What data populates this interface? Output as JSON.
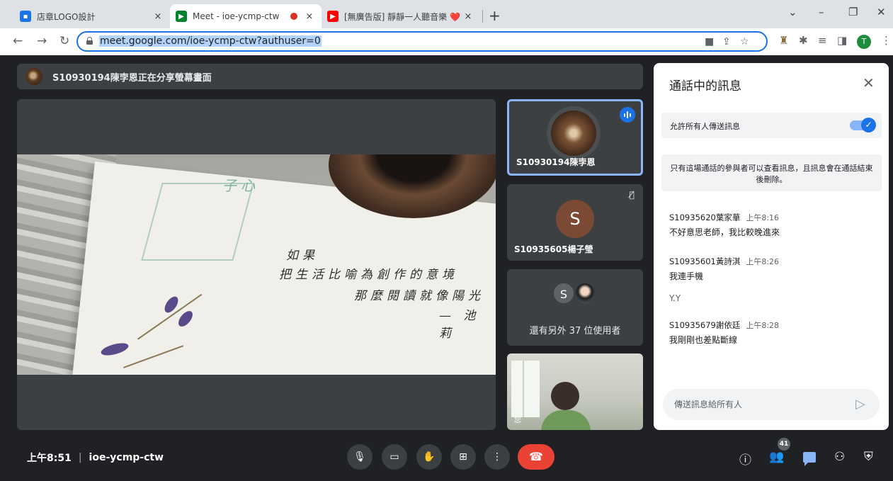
{
  "browser": {
    "tabs": [
      {
        "title": "店章LOGO設計",
        "close": "×",
        "favicon_color": "#1a73e8"
      },
      {
        "title": "Meet - ioe-ycmp-ctw",
        "close": "×",
        "favicon_color": "#00832d"
      },
      {
        "title": "[無廣告版] 靜靜一人聽音樂 ❤️ ",
        "close": "×",
        "favicon_color": "#ff0000"
      }
    ],
    "new_tab": "+",
    "url": "meet.google.com/ioe-ycmp-ctw?authuser=0",
    "profile_initial": "T",
    "window_controls": {
      "collapse": "⌄",
      "minimize": "–",
      "restore": "❐",
      "close": "✕"
    }
  },
  "meet": {
    "presenting_text": "S10930194陳孛恩正在分享螢幕畫面",
    "shared_text": {
      "line1": "如果",
      "line2": "把生活比喻為創作的意境",
      "line3": "那麼閱讀就像陽光",
      "line4": "— 池莉",
      "stamp": "子心"
    },
    "tiles": [
      {
        "name": "S10930194陳孛恩",
        "speaking": true
      },
      {
        "name": "S10935605楊子瑩",
        "initial": "S",
        "muted": true
      }
    ],
    "others_initial": "S",
    "others_text": "還有另外 37 位使用者",
    "self_label": "您"
  },
  "chat": {
    "title": "通話中的訊息",
    "allow_label": "允許所有人傳送訊息",
    "notice": "只有這場通話的參與者可以查看訊息，且訊息會在通話結束後刪除。",
    "messages": [
      {
        "sender": "S10935620葉家華",
        "time": "上午8:16",
        "text": "不好意思老師，我比較晚進來"
      },
      {
        "sender": "S10935601黃詩淇",
        "time": "上午8:26",
        "text": "我連手機",
        "extra": "Y.Y"
      },
      {
        "sender": "S10935679謝依廷",
        "time": "上午8:28",
        "text": "我剛剛也差點斷線"
      }
    ],
    "input_placeholder": "傳送訊息給所有人"
  },
  "bottom": {
    "time": "上午8:51",
    "meeting_code": "ioe-ycmp-ctw",
    "participant_count": "41"
  },
  "colors": {
    "meet_bg": "#202124",
    "tile_bg": "#3c4043",
    "accent_blue": "#1a73e8",
    "hangup_red": "#ea4335"
  }
}
